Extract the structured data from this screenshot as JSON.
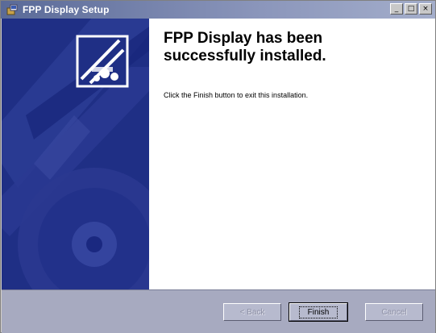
{
  "window": {
    "title": "FPP Display Setup",
    "icon": "installer-icon",
    "controls": {
      "minimize": "_",
      "maximize": "□",
      "close": "×"
    }
  },
  "main": {
    "heading_line1": "FPP Display has been",
    "heading_line2": "successfully installed.",
    "message": "Click the Finish button to exit this installation."
  },
  "footer": {
    "back_label": "< Back",
    "finish_label": "Finish",
    "cancel_label": "Cancel"
  },
  "colors": {
    "banner": "#1f2f85",
    "titlebar": "#5a6a98",
    "footer": "#a7aac0"
  }
}
